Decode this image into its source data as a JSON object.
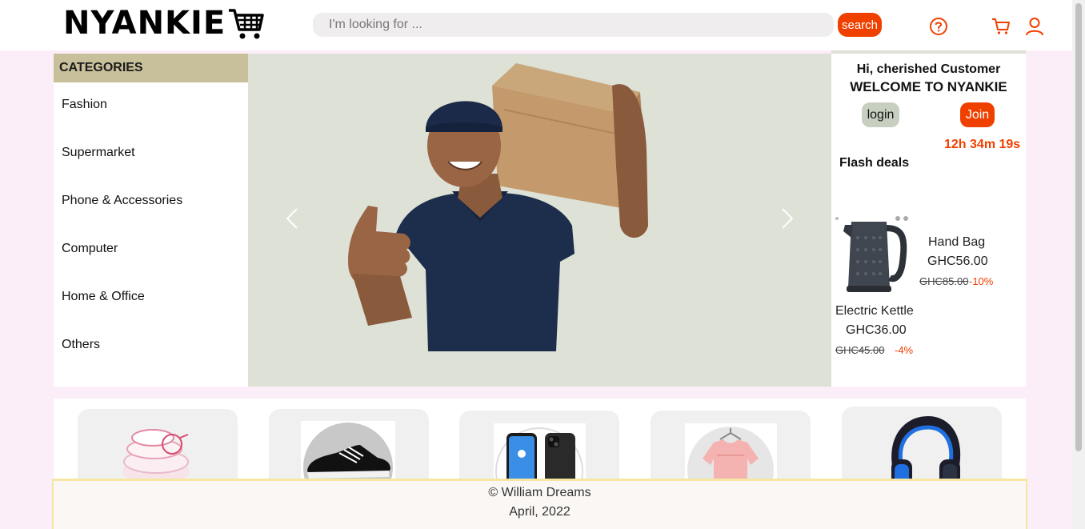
{
  "header": {
    "logo": "NYANKIE",
    "search_placeholder": "I'm looking for ...",
    "search_button": "search",
    "help_icon": "help-circle-icon",
    "cart_icon": "cart-icon",
    "user_icon": "user-icon"
  },
  "categories": {
    "title": "CATEGORIES",
    "items": [
      "Fashion",
      "Supermarket",
      "Phone & Accessories",
      "Computer",
      "Home & Office",
      "Others"
    ]
  },
  "banner": {
    "prev_icon": "chevron-left-icon",
    "next_icon": "chevron-right-icon"
  },
  "welcome": {
    "greeting": "Hi, cherished Customer",
    "headline": "WELCOME TO NYANKIE",
    "login_label": "login",
    "join_label": "Join",
    "timer": "12h 34m 19s",
    "flash_title": "Flash deals"
  },
  "deals": [
    {
      "name": "Hand Bag",
      "price": "GHC56.00",
      "old_price": "GHC85.00",
      "discount": "-10%"
    },
    {
      "name": "Electric Kettle",
      "price": "GHC36.00",
      "old_price": "GHC45.00",
      "discount": "-4%"
    }
  ],
  "footer": {
    "copyright": "© William Dreams",
    "date": "April, 2022"
  },
  "colors": {
    "accent": "#f04000",
    "category_header": "#c8c09a",
    "banner_bg": "#dde1d6",
    "page_bg": "#fbeef8"
  }
}
